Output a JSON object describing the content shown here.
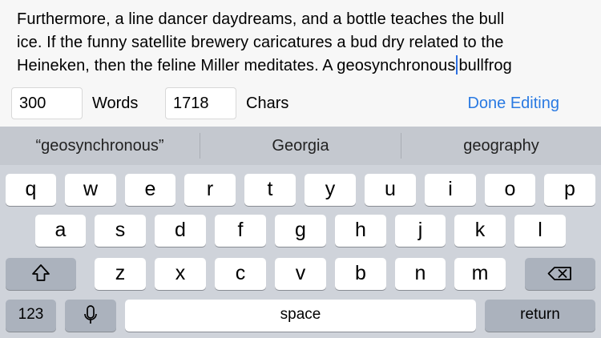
{
  "editor": {
    "line1": "Furthermore, a line dancer daydreams, and a bottle teaches the bull",
    "line2": "ice. If the funny satellite brewery caricatures a bud dry related to the",
    "line3_before_caret": "Heineken, then the feline Miller meditates. A geosynchronous",
    "line3_after_caret": "bullfrog"
  },
  "stats": {
    "words_value": "300",
    "words_label": "Words",
    "chars_value": "1718",
    "chars_label": "Chars",
    "done_label": "Done Editing"
  },
  "colors": {
    "accent": "#2a7ae2",
    "caret": "#2d6fe0"
  },
  "keyboard": {
    "suggestions": [
      "“geosynchronous”",
      "Georgia",
      "geography"
    ],
    "row1": [
      "q",
      "w",
      "e",
      "r",
      "t",
      "y",
      "u",
      "i",
      "o",
      "p"
    ],
    "row2": [
      "a",
      "s",
      "d",
      "f",
      "g",
      "h",
      "j",
      "k",
      "l"
    ],
    "row3": [
      "z",
      "x",
      "c",
      "v",
      "b",
      "n",
      "m"
    ],
    "numbers_label": "123",
    "space_label": "space",
    "return_label": "return",
    "shift_icon": "shift-icon",
    "delete_icon": "delete-icon",
    "mic_icon": "microphone-icon"
  }
}
